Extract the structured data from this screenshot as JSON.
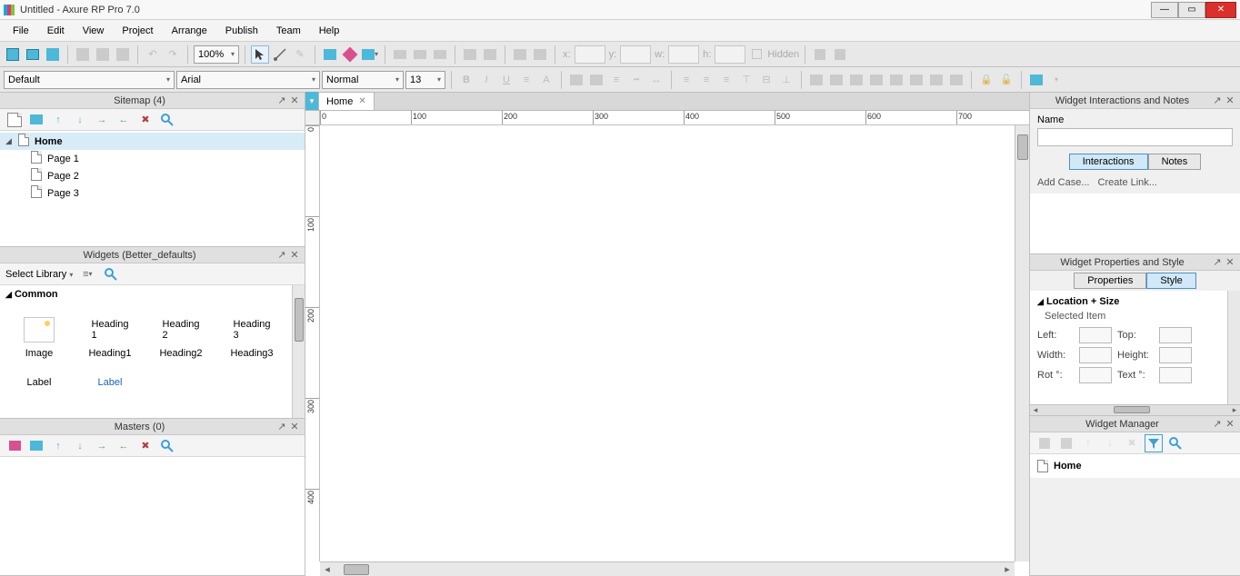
{
  "title": "Untitled - Axure RP Pro 7.0",
  "menu": [
    "File",
    "Edit",
    "View",
    "Project",
    "Arrange",
    "Publish",
    "Team",
    "Help"
  ],
  "zoom": "100%",
  "style_dropdown": "Default",
  "font_dropdown": "Arial",
  "weight_dropdown": "Normal",
  "font_size": "13",
  "hidden_label": "Hidden",
  "coord_labels": {
    "x": "x:",
    "y": "y:",
    "w": "w:",
    "h": "h:"
  },
  "sitemap": {
    "title": "Sitemap (4)",
    "items": [
      {
        "label": "Home",
        "children": [
          "Page 1",
          "Page 2",
          "Page 3"
        ]
      }
    ]
  },
  "widgets_panel": {
    "title": "Widgets (Better_defaults)",
    "select_library": "Select Library",
    "category": "Common",
    "items": [
      "Image",
      "Heading1",
      "Heading2",
      "Heading3",
      "Label",
      "Label"
    ],
    "thumb_text": [
      "",
      "Heading 1",
      "Heading 2",
      "Heading 3",
      "Label",
      "Label"
    ]
  },
  "masters": {
    "title": "Masters (0)"
  },
  "doc": {
    "tab": "Home",
    "ruler_marks": [
      0,
      100,
      200,
      300,
      400,
      500,
      600,
      700
    ],
    "vruler": [
      0,
      100,
      200,
      300,
      400
    ]
  },
  "interactions": {
    "title": "Widget Interactions and Notes",
    "name_label": "Name",
    "tabs": [
      "Interactions",
      "Notes"
    ],
    "links": [
      "Add Case...",
      "Create Link..."
    ]
  },
  "properties": {
    "title": "Widget Properties and Style",
    "tabs": [
      "Properties",
      "Style"
    ],
    "section": "Location + Size",
    "selected_item": "Selected Item",
    "labels": {
      "left": "Left:",
      "top": "Top:",
      "width": "Width:",
      "height": "Height:",
      "rot": "Rot °:",
      "text": "Text °:"
    }
  },
  "widget_manager": {
    "title": "Widget Manager",
    "item": "Home"
  }
}
